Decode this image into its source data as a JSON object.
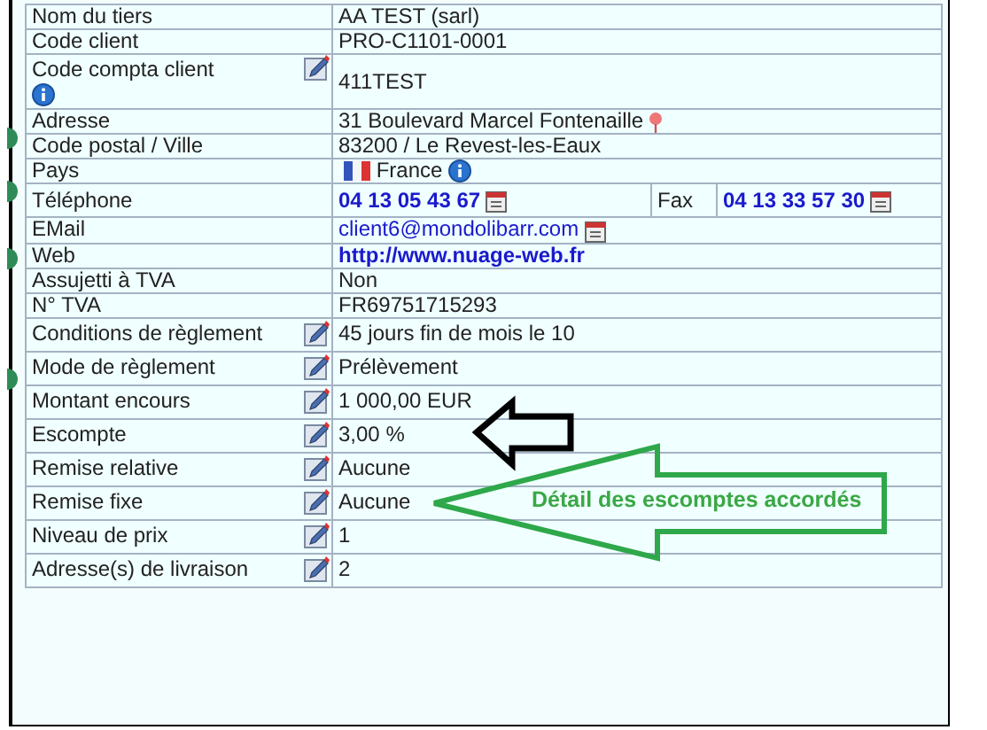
{
  "rows": [
    {
      "label": "Nom du tiers",
      "value": "AA TEST (sarl)",
      "kind": "plain"
    },
    {
      "label": "Code client",
      "value": "PRO-C1101-0001",
      "kind": "plain"
    },
    {
      "label": "Code compta client",
      "value": "411TEST",
      "kind": "compta"
    },
    {
      "label": "Adresse",
      "value": "31 Boulevard Marcel Fontenaille",
      "kind": "address"
    },
    {
      "label": "Code postal / Ville",
      "value": "83200 / Le Revest-les-Eaux",
      "kind": "plain"
    },
    {
      "label": "Pays",
      "value": "France",
      "kind": "country"
    },
    {
      "label": "Téléphone",
      "value": "04 13 05 43 67",
      "kind": "phone",
      "fax_label": "Fax",
      "fax_value": "04 13 33 57 30"
    },
    {
      "label": "EMail",
      "value": "client6@mondolibarr.com",
      "kind": "email"
    },
    {
      "label": "Web",
      "value": "http://www.nuage-web.fr",
      "kind": "web"
    },
    {
      "label": "Assujetti à TVA",
      "value": "Non",
      "kind": "plain"
    },
    {
      "label": "N° TVA",
      "value": "FR69751715293",
      "kind": "plain"
    },
    {
      "label": "Conditions de règlement",
      "value": "45 jours fin de mois le 10",
      "kind": "editable"
    },
    {
      "label": "Mode de règlement",
      "value": "Prélèvement",
      "kind": "editable"
    },
    {
      "label": "Montant encours",
      "value": "1 000,00 EUR",
      "kind": "editable"
    },
    {
      "label": "Escompte",
      "value": "3,00 %",
      "kind": "editable"
    },
    {
      "label": "Remise relative",
      "value": "Aucune",
      "kind": "editable"
    },
    {
      "label": "Remise fixe",
      "value": "Aucune",
      "kind": "editable"
    },
    {
      "label": "Niveau de prix",
      "value": "1",
      "kind": "editable"
    },
    {
      "label": "Adresse(s) de livraison",
      "value": "2",
      "kind": "editable"
    }
  ],
  "annotation": {
    "text": "Détail des escomptes accordés"
  }
}
